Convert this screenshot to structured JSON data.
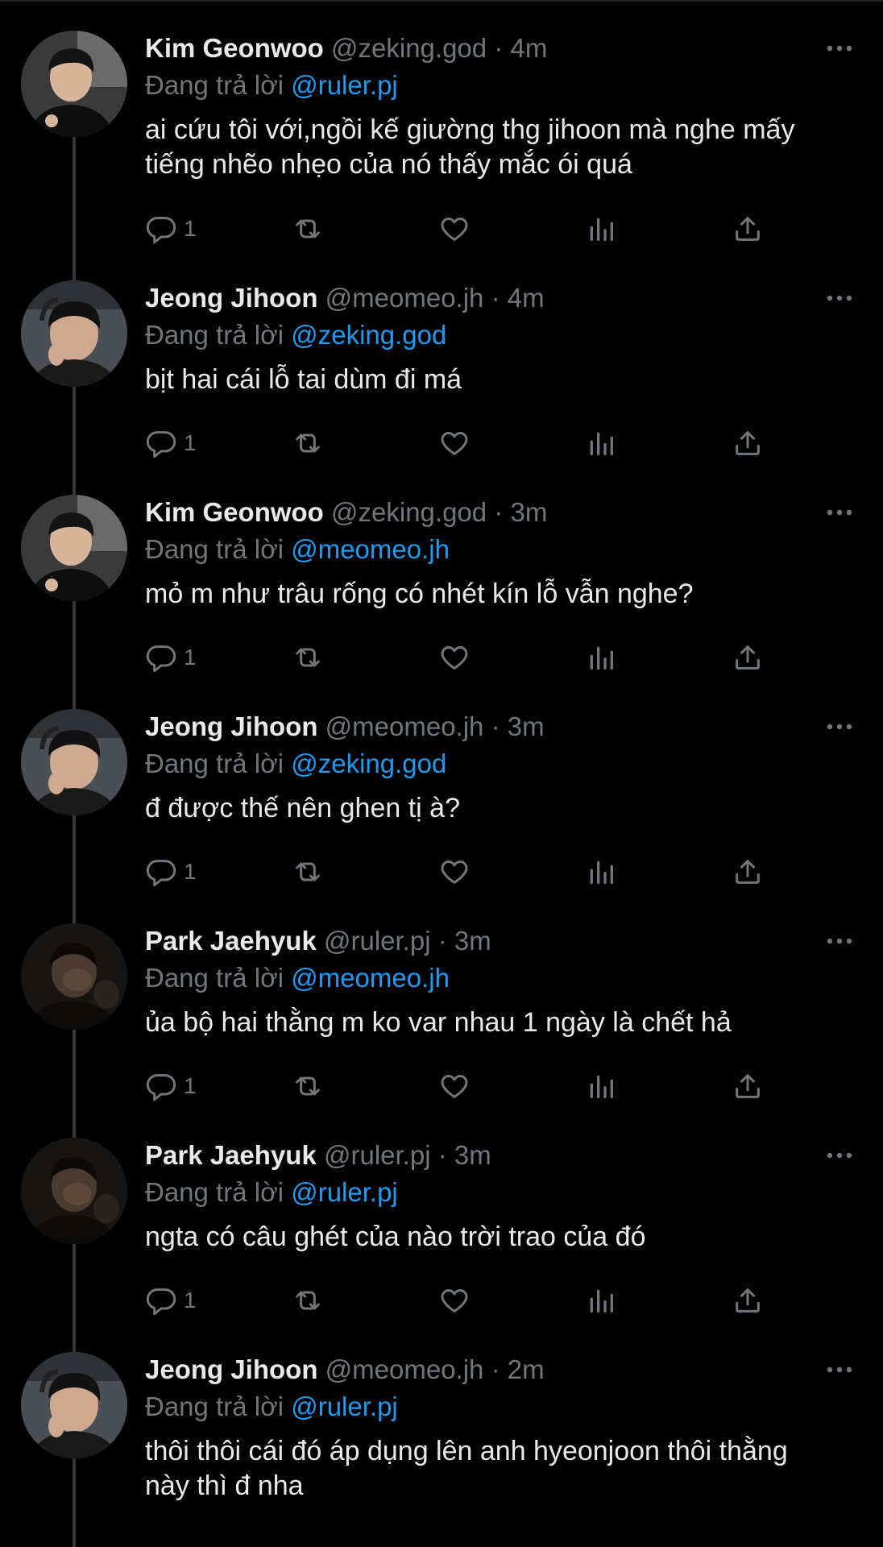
{
  "reply_prefix": "Đang trả lời",
  "colors": {
    "background": "#000000",
    "name": "#e7e9ea",
    "muted": "#71767b",
    "mention": "#1d9bf0",
    "thread_line": "#333639"
  },
  "tweets": [
    {
      "name": "Kim Geonwoo",
      "handle": "@zeking.god",
      "sep": "·",
      "time": "4m",
      "reply_to": "@ruler.pj",
      "text": "ai cứu tôi với,ngồi kế giường thg jihoon mà nghe mấy tiếng nhẽo nhẹo của nó thấy mắc ói quá",
      "reply_count": "1",
      "avatar": "kim-avatar"
    },
    {
      "name": "Jeong Jihoon",
      "handle": "@meomeo.jh",
      "sep": "·",
      "time": "4m",
      "reply_to": "@zeking.god",
      "text": "bịt hai cái lỗ tai dùm đi má",
      "reply_count": "1",
      "avatar": "jeong-avatar"
    },
    {
      "name": "Kim Geonwoo",
      "handle": "@zeking.god",
      "sep": "·",
      "time": "3m",
      "reply_to": "@meomeo.jh",
      "text": "mỏ m như trâu rống có nhét kín lỗ vẫn nghe?",
      "reply_count": "1",
      "avatar": "kim-avatar"
    },
    {
      "name": "Jeong Jihoon",
      "handle": "@meomeo.jh",
      "sep": "·",
      "time": "3m",
      "reply_to": "@zeking.god",
      "text": "đ được thế nên ghen tị à?",
      "reply_count": "1",
      "avatar": "jeong-avatar"
    },
    {
      "name": "Park Jaehyuk",
      "handle": "@ruler.pj",
      "sep": "·",
      "time": "3m",
      "reply_to": "@meomeo.jh",
      "text": "ủa bộ hai thằng m ko var nhau 1 ngày là chết hả",
      "reply_count": "1",
      "avatar": "park-avatar"
    },
    {
      "name": "Park Jaehyuk",
      "handle": "@ruler.pj",
      "sep": "·",
      "time": "3m",
      "reply_to": "@ruler.pj",
      "text": "ngta có câu ghét của nào trời trao của đó",
      "reply_count": "1",
      "avatar": "park-avatar"
    },
    {
      "name": "Jeong Jihoon",
      "handle": "@meomeo.jh",
      "sep": "·",
      "time": "2m",
      "reply_to": "@ruler.pj",
      "text": "thôi thôi cái đó áp dụng lên anh hyeonjoon thôi thằng này thì đ nha",
      "reply_count": "",
      "avatar": "jeong-avatar"
    }
  ]
}
